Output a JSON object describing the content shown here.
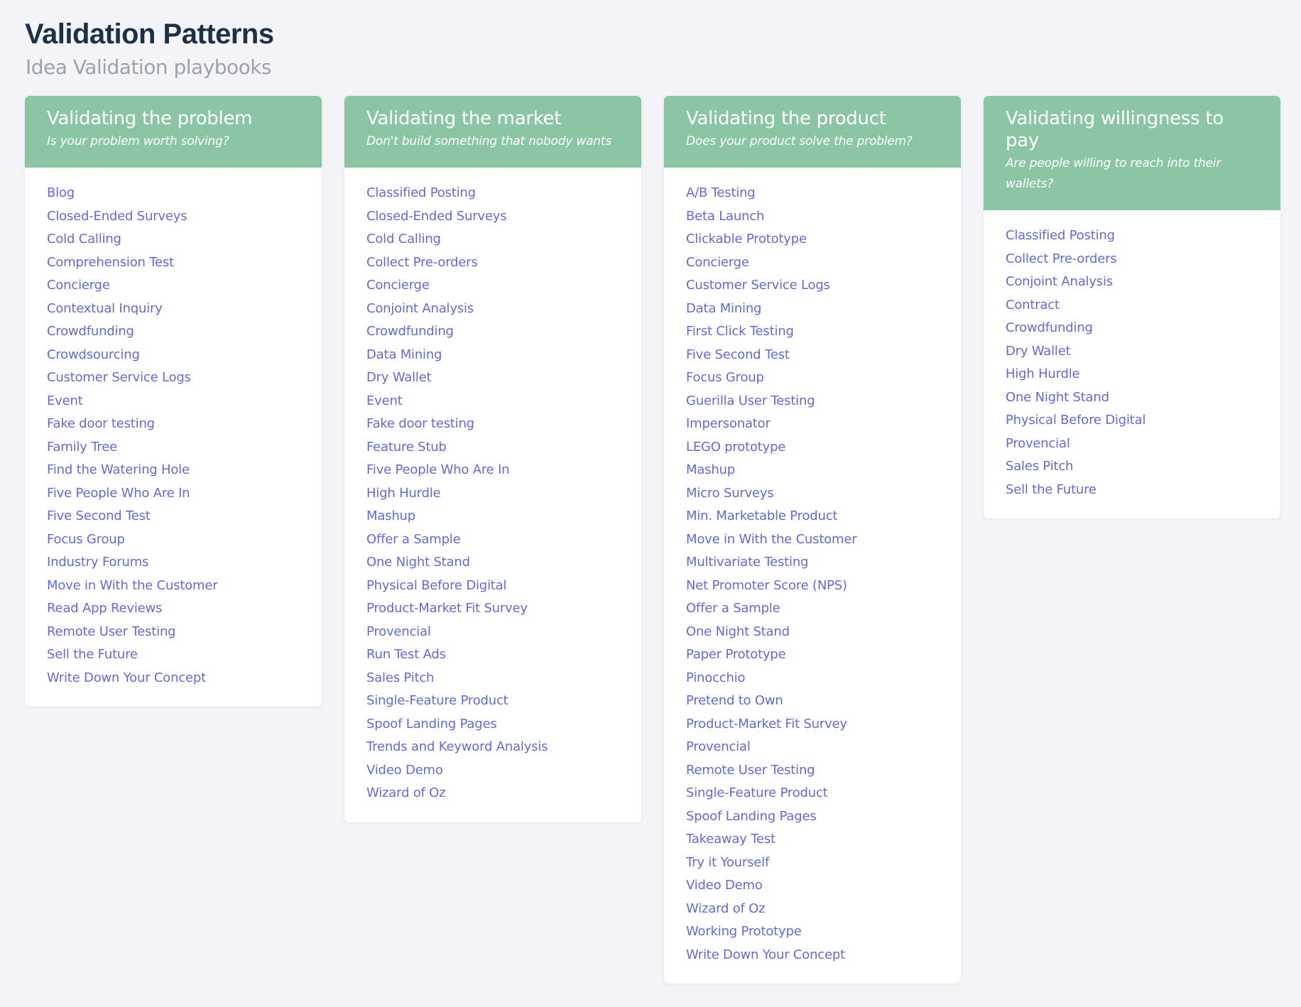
{
  "header": {
    "title": "Validation Patterns",
    "subtitle": "Idea Validation playbooks"
  },
  "colors": {
    "header_bg": "#8cc5a4",
    "link": "#6569d8",
    "title": "#1f2f44"
  },
  "cards": [
    {
      "title": "Validating the problem",
      "subtitle": "Is your problem worth solving?",
      "items": [
        "Blog",
        "Closed-Ended Surveys",
        "Cold Calling",
        "Comprehension Test",
        "Concierge",
        "Contextual Inquiry",
        "Crowdfunding",
        "Crowdsourcing",
        "Customer Service Logs",
        "Event",
        "Fake door testing",
        "Family Tree",
        "Find the Watering Hole",
        "Five People Who Are In",
        "Five Second Test",
        "Focus Group",
        "Industry Forums",
        "Move in With the Customer",
        "Read App Reviews",
        "Remote User Testing",
        "Sell the Future",
        "Write Down Your Concept"
      ]
    },
    {
      "title": "Validating the market",
      "subtitle": "Don't build something that nobody wants",
      "items": [
        "Classified Posting",
        "Closed-Ended Surveys",
        "Cold Calling",
        "Collect Pre-orders",
        "Concierge",
        "Conjoint Analysis",
        "Crowdfunding",
        "Data Mining",
        "Dry Wallet",
        "Event",
        "Fake door testing",
        "Feature Stub",
        "Five People Who Are In",
        "High Hurdle",
        "Mashup",
        "Offer a Sample",
        "One Night Stand",
        "Physical Before Digital",
        "Product-Market Fit Survey",
        "Provencial",
        "Run Test Ads",
        "Sales Pitch",
        "Single-Feature Product",
        "Spoof Landing Pages",
        "Trends and Keyword Analysis",
        "Video Demo",
        "Wizard of Oz"
      ]
    },
    {
      "title": "Validating the product",
      "subtitle": "Does your product solve the problem?",
      "items": [
        "A/B Testing",
        "Beta Launch",
        "Clickable Prototype",
        "Concierge",
        "Customer Service Logs",
        "Data Mining",
        "First Click Testing",
        "Five Second Test",
        "Focus Group",
        "Guerilla User Testing",
        "Impersonator",
        "LEGO prototype",
        "Mashup",
        "Micro Surveys",
        "Min. Marketable Product",
        "Move in With the Customer",
        "Multivariate Testing",
        "Net Promoter Score (NPS)",
        "Offer a Sample",
        "One Night Stand",
        "Paper Prototype",
        "Pinocchio",
        "Pretend to Own",
        "Product-Market Fit Survey",
        "Provencial",
        "Remote User Testing",
        "Single-Feature Product",
        "Spoof Landing Pages",
        "Takeaway Test",
        "Try it Yourself",
        "Video Demo",
        "Wizard of Oz",
        "Working Prototype",
        "Write Down Your Concept"
      ]
    },
    {
      "title": "Validating willingness to pay",
      "subtitle": "Are people willing to reach into their wallets?",
      "items": [
        "Classified Posting",
        "Collect Pre-orders",
        "Conjoint Analysis",
        "Contract",
        "Crowdfunding",
        "Dry Wallet",
        "High Hurdle",
        "One Night Stand",
        "Physical Before Digital",
        "Provencial",
        "Sales Pitch",
        "Sell the Future"
      ]
    }
  ]
}
